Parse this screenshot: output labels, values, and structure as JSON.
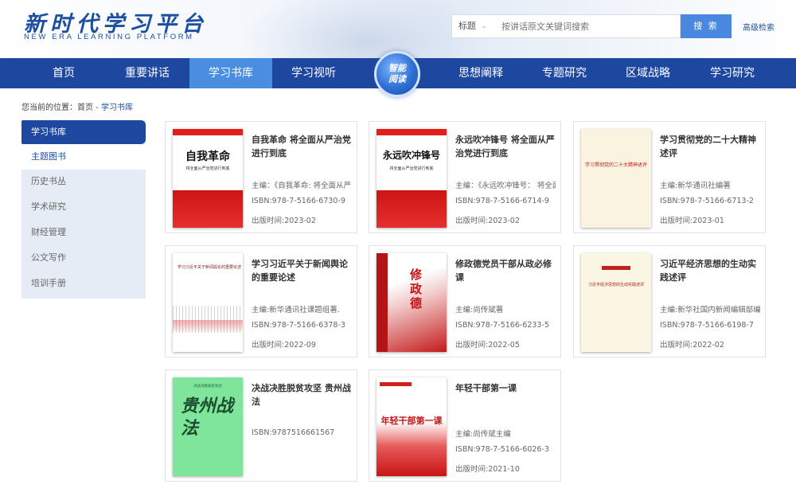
{
  "header": {
    "logo_cn": "新时代学习平台",
    "logo_en": "NEW ERA LEARNING PLATFORM",
    "search_type": "标题",
    "search_placeholder": "按讲话原文关键词搜索",
    "search_button": "搜 索",
    "advanced_search": "高级检索"
  },
  "nav": {
    "items": [
      "首页",
      "重要讲话",
      "学习书库",
      "学习视听",
      "思想阐释",
      "专题研究",
      "区域战略",
      "学习研究"
    ],
    "active": "学习书库",
    "badge_line1": "智能",
    "badge_line2": "阅读"
  },
  "breadcrumb": {
    "prefix": "您当前的位置：",
    "home": "首页",
    "sep": " - ",
    "current": "学习书库"
  },
  "sidebar": {
    "items": [
      "学习书库",
      "主题图书",
      "历史书丛",
      "学术研究",
      "财经管理",
      "公文写作",
      "培训手册"
    ]
  },
  "books": [
    {
      "title": "自我革命 将全面从严治党进行到底",
      "editor": "主编：《自我革命: 将全面从严治党进行到底》编写组",
      "isbn": "ISBN:978-7-5166-6730-9",
      "date": "出版时间:2023-02",
      "cover_text": "自我革命",
      "cover_sub": "将全面从严治党进行到底"
    },
    {
      "title": "永远吹冲锋号 将全面从严治党进行到底",
      "editor": "主编：《永远吹冲锋号： 将全面从严治党进行到底》编写组",
      "isbn": "ISBN:978-7-5166-6714-9",
      "date": "出版时间:2023-02",
      "cover_text": "永远吹冲锋号",
      "cover_sub": "将全面从严治党进行到底"
    },
    {
      "title": "学习贯彻党的二十大精神述评",
      "editor": "主编:新华通讯社编著",
      "isbn": "ISBN:978-7-5166-6713-2",
      "date": "出版时间:2023-01",
      "cover_text": "学习贯彻党的二十大精神述评"
    },
    {
      "title": "学习习近平关于新闻舆论的重要论述",
      "editor": "主编:新华通讯社课题组著.",
      "isbn": "ISBN:978-7-5166-6378-3",
      "date": "出版时间:2022-09",
      "cover_text": "学习习近平关于新闻舆论的重要论述"
    },
    {
      "title": "修政德党员干部从政必修课",
      "editor": "主编:尚传斌著",
      "isbn": "ISBN:978-7-5166-6233-5",
      "date": "出版时间:2022-05",
      "cover_text": "修政德"
    },
    {
      "title": "习近平经济思想的生动实践述评",
      "editor": "主编:新华社国内新闻编辑部编",
      "isbn": "ISBN:978-7-5166-6198-7",
      "date": "出版时间:2022-02",
      "cover_text": "习近平经济思想的生动实践述评"
    },
    {
      "title": "决战决胜脱贫攻坚 贵州战法",
      "isbn": "ISBN:9787516661567",
      "cover_header": "决战决胜脱贫攻坚",
      "cover_text": "贵州战法"
    },
    {
      "title": "年轻干部第一课",
      "editor": "主编:尚传斌主编",
      "isbn": "ISBN:978-7-5166-6026-3",
      "date": "出版时间:2021-10",
      "cover_text": "年轻干部第一课"
    }
  ],
  "colors": {
    "primary": "#1e47a0",
    "nav_active": "#4a8ee2",
    "search_button": "#4a88e0",
    "sidebar_bg": "#e6ecf5"
  }
}
